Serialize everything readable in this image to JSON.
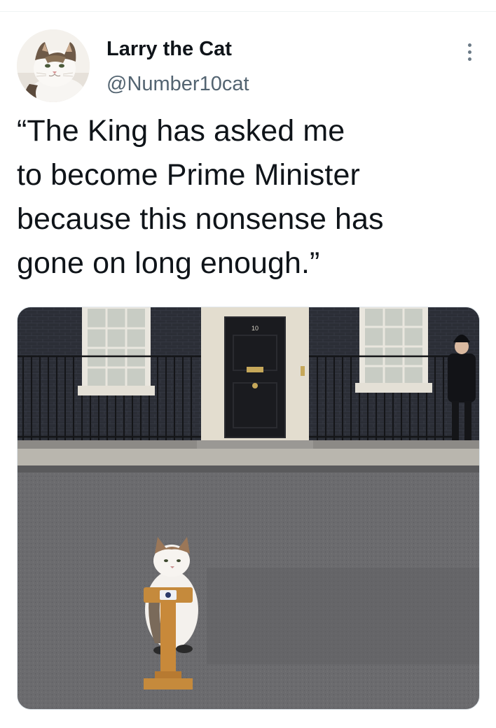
{
  "tweet": {
    "author": {
      "display_name": "Larry the Cat",
      "handle": "@Number10cat",
      "avatar_icon": "cat-avatar"
    },
    "more_icon": "more-dots-icon",
    "text": "“The King has asked me\nto become Prime Minister\nbecause this nonsense has\ngone on long enough.”",
    "media": {
      "door_number": "10"
    }
  },
  "colors": {
    "text_primary": "#0f1419",
    "text_secondary": "#536471",
    "divider": "#eff3f4"
  }
}
